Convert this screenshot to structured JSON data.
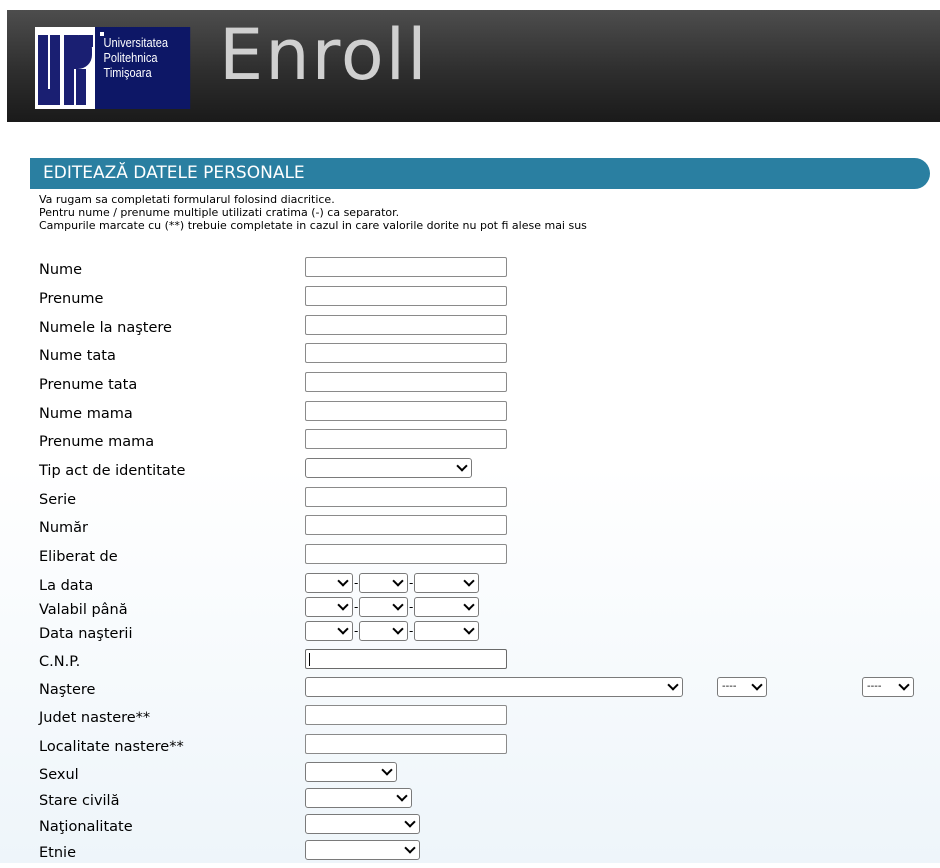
{
  "header": {
    "logo_lines": [
      "Universitatea",
      "Politehnica",
      "Timişoara"
    ],
    "app_title": "Enroll"
  },
  "section": {
    "title": "EDITEAZĂ DATELE PERSONALE",
    "notes": [
      "Va rugam sa completati formularul folosind diacritice.",
      "Pentru nume / prenume multiple utilizati cratima (-) ca separator.",
      "Campurile marcate cu (**) trebuie completate in cazul in care valorile dorite nu pot fi alese mai sus"
    ]
  },
  "form": {
    "nume": {
      "label": "Nume",
      "value": ""
    },
    "prenume": {
      "label": "Prenume",
      "value": ""
    },
    "numele_la_nastere": {
      "label": "Numele la naştere",
      "value": ""
    },
    "nume_tata": {
      "label": "Nume tata",
      "value": ""
    },
    "prenume_tata": {
      "label": "Prenume tata",
      "value": ""
    },
    "nume_mama": {
      "label": "Nume mama",
      "value": ""
    },
    "prenume_mama": {
      "label": "Prenume mama",
      "value": ""
    },
    "tip_act": {
      "label": "Tip act de identitate",
      "value": ""
    },
    "serie": {
      "label": "Serie",
      "value": ""
    },
    "numar": {
      "label": "Număr",
      "value": ""
    },
    "eliberat_de": {
      "label": "Eliberat de",
      "value": ""
    },
    "la_data": {
      "label": "La data",
      "sep": "-"
    },
    "valabil_pana": {
      "label": "Valabil până",
      "sep": "-"
    },
    "data_nasterii": {
      "label": "Data naşterii",
      "sep": "-"
    },
    "cnp": {
      "label": "C.N.P.",
      "value": ""
    },
    "nastere": {
      "label": "Naştere",
      "country": "",
      "county": "----",
      "locality": "----"
    },
    "judet_nastere": {
      "label": "Judet nastere**",
      "value": ""
    },
    "localitate_nastere": {
      "label": "Localitate nastere**",
      "value": ""
    },
    "sexul": {
      "label": "Sexul",
      "value": ""
    },
    "stare_civila": {
      "label": "Stare civilă",
      "value": ""
    },
    "nationalitate": {
      "label": "Naţionalitate",
      "value": ""
    },
    "etnie": {
      "label": "Etnie",
      "value": ""
    }
  }
}
